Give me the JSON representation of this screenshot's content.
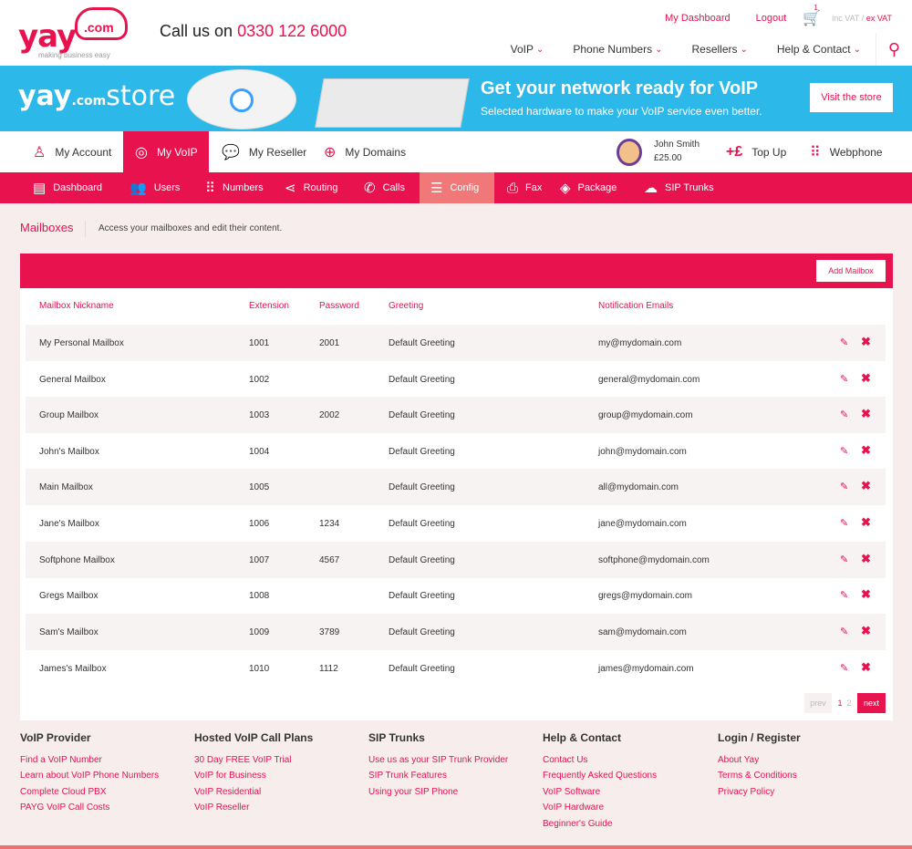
{
  "header": {
    "logo_main": "yay",
    "logo_com": ".com",
    "tagline": "making business easy",
    "call_prefix": "Call us on",
    "call_number": "0330 122 6000",
    "dashboard_link": "My Dashboard",
    "logout_link": "Logout",
    "cart_count": "1",
    "inc_vat": "inc VAT",
    "vat_sep": "/",
    "ex_vat": "ex VAT",
    "nav": [
      {
        "label": "VoIP"
      },
      {
        "label": "Phone Numbers"
      },
      {
        "label": "Resellers"
      },
      {
        "label": "Help & Contact"
      }
    ]
  },
  "banner": {
    "logo_yay": "yay",
    "logo_com": ".com",
    "logo_store": "store",
    "title": "Get your network ready for VoIP",
    "subtitle": "Selected hardware to make your VoIP service even better.",
    "button": "Visit the store"
  },
  "account_bar": {
    "items": [
      {
        "label": "My Account"
      },
      {
        "label": "My VoIP"
      },
      {
        "label": "My Reseller"
      },
      {
        "label": "My Domains"
      }
    ],
    "user_name": "John Smith",
    "user_balance": "£25.00",
    "topup": "Top Up",
    "webphone": "Webphone"
  },
  "subnav": [
    {
      "label": "Dashboard"
    },
    {
      "label": "Users"
    },
    {
      "label": "Numbers"
    },
    {
      "label": "Routing"
    },
    {
      "label": "Calls"
    },
    {
      "label": "Config"
    },
    {
      "label": "Fax"
    },
    {
      "label": "Package"
    },
    {
      "label": "SIP Trunks"
    }
  ],
  "page": {
    "title": "Mailboxes",
    "description": "Access your mailboxes and edit their content."
  },
  "table": {
    "add_button": "Add Mailbox",
    "headers": [
      "Mailbox Nickname",
      "Extension",
      "Password",
      "Greeting",
      "Notification Emails"
    ],
    "rows": [
      {
        "name": "My Personal Mailbox",
        "ext": "1001",
        "pw": "2001",
        "greeting": "Default Greeting",
        "email": "my@mydomain.com"
      },
      {
        "name": "General Mailbox",
        "ext": "1002",
        "pw": "",
        "greeting": "Default Greeting",
        "email": "general@mydomain.com"
      },
      {
        "name": "Group Mailbox",
        "ext": "1003",
        "pw": "2002",
        "greeting": "Default Greeting",
        "email": "group@mydomain.com"
      },
      {
        "name": "John's Mailbox",
        "ext": "1004",
        "pw": "",
        "greeting": "Default Greeting",
        "email": "john@mydomain.com"
      },
      {
        "name": "Main Mailbox",
        "ext": "1005",
        "pw": "",
        "greeting": "Default Greeting",
        "email": "all@mydomain.com"
      },
      {
        "name": "Jane's Mailbox",
        "ext": "1006",
        "pw": "1234",
        "greeting": "Default Greeting",
        "email": "jane@mydomain.com"
      },
      {
        "name": "Softphone Mailbox",
        "ext": "1007",
        "pw": "4567",
        "greeting": "Default Greeting",
        "email": "softphone@mydomain.com"
      },
      {
        "name": "Gregs Mailbox",
        "ext": "1008",
        "pw": "",
        "greeting": "Default Greeting",
        "email": "gregs@mydomain.com"
      },
      {
        "name": "Sam's Mailbox",
        "ext": "1009",
        "pw": "3789",
        "greeting": "Default Greeting",
        "email": "sam@mydomain.com"
      },
      {
        "name": "James's Mailbox",
        "ext": "1010",
        "pw": "1112",
        "greeting": "Default Greeting",
        "email": "james@mydomain.com"
      }
    ],
    "pager": {
      "prev": "prev",
      "page1": "1",
      "page2": "2",
      "next": "next"
    }
  },
  "footer": [
    {
      "title": "VoIP Provider",
      "links": [
        "Find a VoIP Number",
        "Learn about VoIP Phone Numbers",
        "Complete Cloud PBX",
        "PAYG VoIP Call Costs"
      ]
    },
    {
      "title": "Hosted VoIP Call Plans",
      "links": [
        "30 Day FREE VoIP Trial",
        "VoIP for Business",
        "VoIP Residential",
        "VoIP Reseller"
      ]
    },
    {
      "title": "SIP Trunks",
      "links": [
        "Use us as your SIP Trunk Provider",
        "SIP Trunk Features",
        "Using your SIP Phone"
      ]
    },
    {
      "title": "Help & Contact",
      "links": [
        "Contact Us",
        "Frequently Asked Questions",
        "VoIP Software",
        "VoIP Hardware",
        "Beginner's Guide"
      ]
    },
    {
      "title": "Login / Register",
      "links": [
        "About Yay",
        "Terms & Conditions",
        "Privacy Policy"
      ]
    }
  ]
}
